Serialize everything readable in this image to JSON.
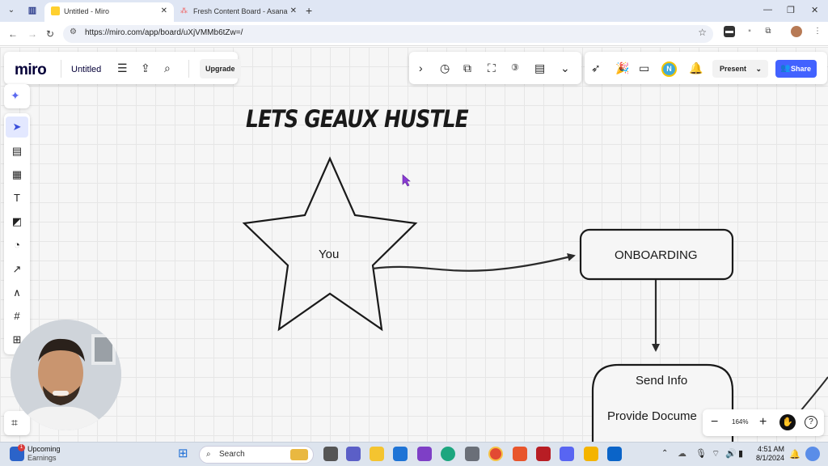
{
  "browser": {
    "tabs": [
      {
        "title": "Untitled - Miro",
        "active": true
      },
      {
        "title": "Fresh Content Board - Asana",
        "active": false
      }
    ],
    "url": "https://miro.com/app/board/uXjVMMb6tZw=/"
  },
  "miro": {
    "logo": "miro",
    "board_title": "Untitled",
    "upgrade_label": "Upgrade",
    "collaborator_initial": "N",
    "present_label": "Present",
    "share_label": "Share",
    "zoom_level": "164%"
  },
  "board": {
    "heading": "LETS GEAUX HUSTLE",
    "star_label": "You",
    "onboarding_label": "ONBOARDING",
    "send_info_label": "Send Info",
    "provide_docs_label": "Provide Docume"
  },
  "taskbar": {
    "weather_title": "Upcoming",
    "weather_sub": "Earnings",
    "weather_badge": "1",
    "search_placeholder": "Search",
    "time": "4:51 AM",
    "date": "8/1/2024"
  },
  "colors": {
    "accent": "#4262ff",
    "tabbar": "#dfe6f4",
    "canvas": "#f6f6f6"
  }
}
